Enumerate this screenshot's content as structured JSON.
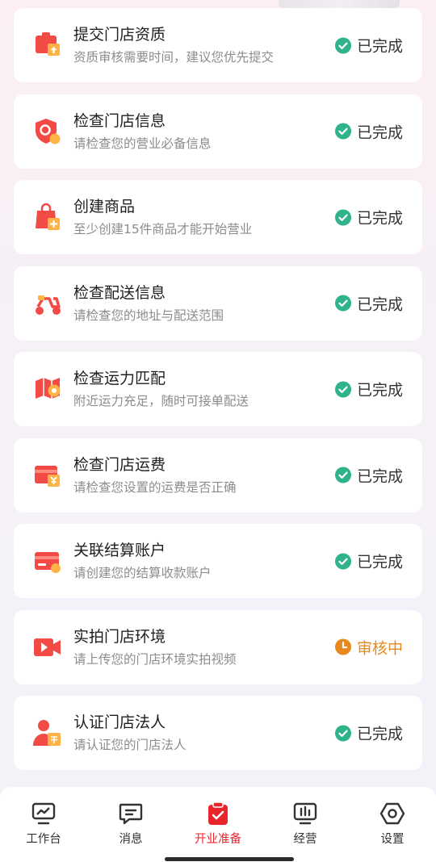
{
  "tasks": [
    {
      "title": "提交门店资质",
      "subtitle": "资质审核需要时间，建议您优先提交",
      "status": "已完成",
      "icon": "upload-store-icon"
    },
    {
      "title": "检查门店信息",
      "subtitle": "请检查您的营业必备信息",
      "status": "已完成",
      "icon": "search-shield-icon"
    },
    {
      "title": "创建商品",
      "subtitle": "至少创建15件商品才能开始营业",
      "status": "已完成",
      "icon": "shopping-bag-add-icon"
    },
    {
      "title": "检查配送信息",
      "subtitle": "请检查您的地址与配送范围",
      "status": "已完成",
      "icon": "scooter-icon"
    },
    {
      "title": "检查运力匹配",
      "subtitle": "附近运力充足，随时可接单配送",
      "status": "已完成",
      "icon": "map-pin-icon"
    },
    {
      "title": "检查门店运费",
      "subtitle": "请检查您设置的运费是否正确",
      "status": "已完成",
      "icon": "freight-fee-icon"
    },
    {
      "title": "关联结算账户",
      "subtitle": "请创建您的结算收款账户",
      "status": "已完成",
      "icon": "bank-card-icon"
    },
    {
      "title": "实拍门店环境",
      "subtitle": "请上传您的门店环境实拍视频",
      "status": "审核中",
      "icon": "video-camera-icon"
    },
    {
      "title": "认证门店法人",
      "subtitle": "请认证您的门店法人",
      "status": "已完成",
      "icon": "person-id-icon"
    }
  ],
  "tabs": [
    {
      "label": "工作台",
      "icon": "dashboard-icon"
    },
    {
      "label": "消息",
      "icon": "message-icon"
    },
    {
      "label": "开业准备",
      "icon": "clipboard-check-icon",
      "active": true
    },
    {
      "label": "经营",
      "icon": "stats-icon"
    },
    {
      "label": "设置",
      "icon": "settings-hex-icon"
    }
  ],
  "colors": {
    "accent": "#e8252b",
    "done": "#2fb38a",
    "review": "#e8891e"
  }
}
